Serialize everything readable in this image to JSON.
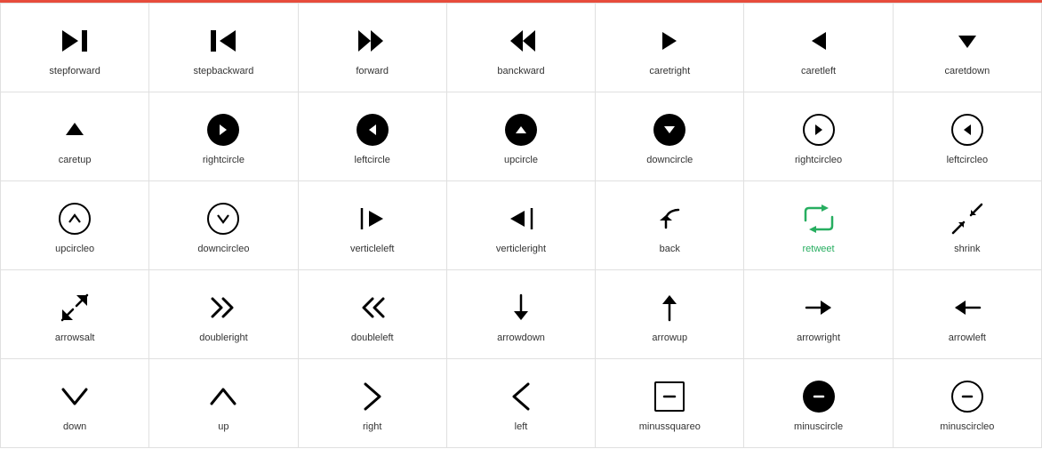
{
  "icons": [
    {
      "id": "stepforward",
      "label": "stepforward",
      "type": "text",
      "symbol": "⊣",
      "unicode": "⏭",
      "render": "step-forward"
    },
    {
      "id": "stepbackward",
      "label": "stepbackward",
      "type": "text",
      "symbol": "⏮",
      "render": "step-backward"
    },
    {
      "id": "forward",
      "label": "forward",
      "type": "text",
      "symbol": "⏩",
      "render": "fast-forward"
    },
    {
      "id": "banckward",
      "label": "banckward",
      "type": "text",
      "symbol": "⏪",
      "render": "fast-backward"
    },
    {
      "id": "caretright",
      "label": "caretright",
      "type": "text",
      "symbol": "▶",
      "render": "caret-right"
    },
    {
      "id": "caretleft",
      "label": "caretleft",
      "type": "text",
      "symbol": "◀",
      "render": "caret-left"
    },
    {
      "id": "caretdown",
      "label": "caretdown",
      "type": "text",
      "symbol": "▼",
      "render": "caret-down"
    },
    {
      "id": "caretup",
      "label": "caretup",
      "type": "text",
      "symbol": "▲",
      "render": "caret-up"
    },
    {
      "id": "rightcircle",
      "label": "rightcircle",
      "type": "filled-circle",
      "symbol": "❯",
      "render": "right-circle"
    },
    {
      "id": "leftcircle",
      "label": "leftcircle",
      "type": "filled-circle",
      "symbol": "❮",
      "render": "left-circle"
    },
    {
      "id": "upcircle",
      "label": "upcircle",
      "type": "filled-circle",
      "symbol": "❮",
      "render": "up-circle"
    },
    {
      "id": "downcircle",
      "label": "downcircle",
      "type": "filled-circle",
      "symbol": "❯",
      "render": "down-circle"
    },
    {
      "id": "rightcircleo",
      "label": "rightcircleo",
      "type": "outline-circle",
      "symbol": "❯",
      "render": "right-circleo"
    },
    {
      "id": "leftcircleo",
      "label": "leftcircleo",
      "type": "outline-circle",
      "symbol": "❮",
      "render": "left-circleo"
    },
    {
      "id": "upcircleo",
      "label": "upcircleo",
      "type": "outline-circle",
      "symbol": "∧",
      "render": "up-circleo"
    },
    {
      "id": "downcircleo",
      "label": "downcircleo",
      "type": "outline-circle",
      "symbol": "∨",
      "render": "down-circleo"
    },
    {
      "id": "verticleleft",
      "label": "verticleleft",
      "type": "text",
      "symbol": "⇤",
      "render": "verticle-left"
    },
    {
      "id": "verticleright",
      "label": "verticleright",
      "type": "text",
      "symbol": "⇥",
      "render": "verticle-right"
    },
    {
      "id": "back",
      "label": "back",
      "type": "text",
      "symbol": "↩",
      "render": "back"
    },
    {
      "id": "retweet",
      "label": "retweet",
      "type": "text",
      "symbol": "⇄",
      "render": "retweet",
      "green": true
    },
    {
      "id": "shrink",
      "label": "shrink",
      "type": "text",
      "symbol": "⇙⇗",
      "render": "shrink"
    },
    {
      "id": "arrowsalt",
      "label": "arrowsalt",
      "type": "text",
      "symbol": "⇗⇙",
      "render": "arrows-alt"
    },
    {
      "id": "doubleright",
      "label": "doubleright",
      "type": "text",
      "symbol": "»",
      "render": "double-right"
    },
    {
      "id": "doubleleft",
      "label": "doubleleft",
      "type": "text",
      "symbol": "«",
      "render": "double-left"
    },
    {
      "id": "arrowdown",
      "label": "arrowdown",
      "type": "text",
      "symbol": "↓",
      "render": "arrow-down"
    },
    {
      "id": "arrowup",
      "label": "arrowup",
      "type": "text",
      "symbol": "↑",
      "render": "arrow-up"
    },
    {
      "id": "arrowright",
      "label": "arrowright",
      "type": "text",
      "symbol": "→",
      "render": "arrow-right"
    },
    {
      "id": "arrowleft",
      "label": "arrowleft",
      "type": "text",
      "symbol": "←",
      "render": "arrow-left"
    },
    {
      "id": "down",
      "label": "down",
      "type": "text",
      "symbol": "∨",
      "render": "down"
    },
    {
      "id": "up",
      "label": "up",
      "type": "text",
      "symbol": "∧",
      "render": "up"
    },
    {
      "id": "right",
      "label": "right",
      "type": "text",
      "symbol": "›",
      "render": "right"
    },
    {
      "id": "left",
      "label": "left",
      "type": "text",
      "symbol": "‹",
      "render": "left"
    },
    {
      "id": "minussquareo",
      "label": "minussquareo",
      "type": "square-outline",
      "symbol": "−",
      "render": "minus-squareo"
    },
    {
      "id": "minuscircle",
      "label": "minuscircle",
      "type": "filled-circle-minus",
      "symbol": "−",
      "render": "minus-circle"
    },
    {
      "id": "minuscircleo",
      "label": "minuscircleo",
      "type": "outline-circle-minus",
      "symbol": "−",
      "render": "minus-circleo"
    }
  ]
}
